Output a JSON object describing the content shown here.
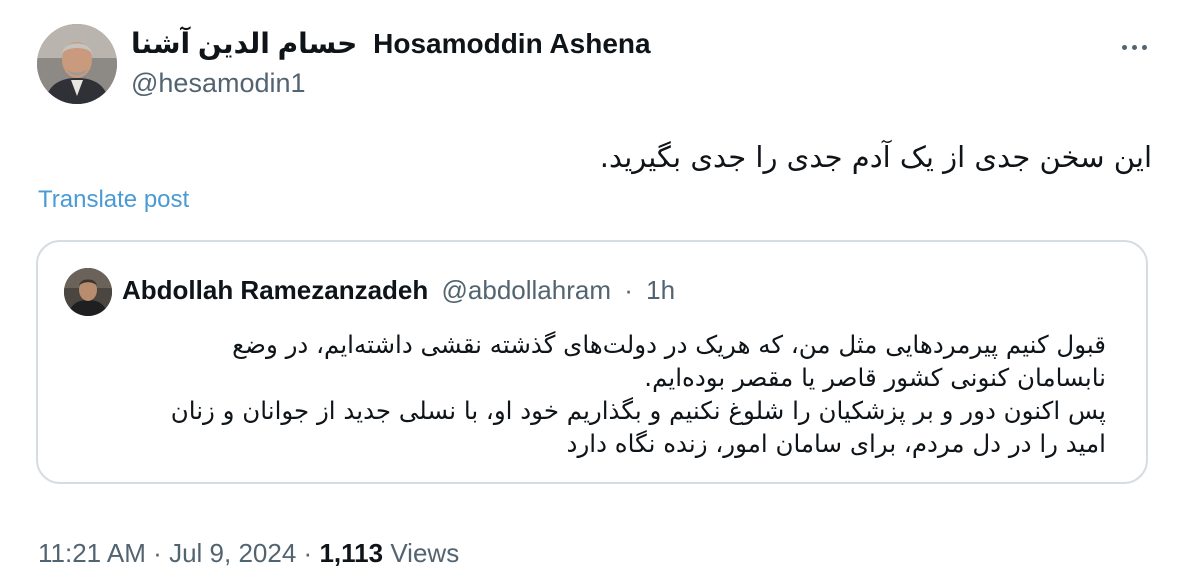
{
  "author": {
    "name_persian": "حسام الدین آشنا",
    "name_latin": "Hosamoddin Ashena",
    "handle": "@hesamodin1"
  },
  "icons": {
    "more": "more-horizontal-icon"
  },
  "tweet": {
    "text": "این سخن جدی از یک آدم جدی را جدی بگیرید.",
    "translate_label": "Translate post"
  },
  "quote": {
    "name": "Abdollah Ramezanzadeh",
    "handle": "@abdollahram",
    "separator": "·",
    "time": "1h",
    "lines": [
      "قبول کنیم پیرمردهایی مثل من، که هریک در دولت‌های گذشته نقشی داشته‌ایم، در وضع",
      "نابسامان کنونی کشور قاصر یا مقصر بوده‌ایم.",
      "پس اکنون دور و بر پزشکیان را شلوغ نکنیم و بگذاریم خود او، با نسلی جدید از جوانان و زنان",
      "امید را در دل مردم، برای سامان امور، زنده نگاه دارد"
    ]
  },
  "footer": {
    "time": "11:21 AM",
    "sep": "·",
    "date": "Jul 9, 2024",
    "views_count": "1,113",
    "views_label": "Views"
  },
  "colors": {
    "link": "#4a9ad4",
    "secondary": "#536471",
    "border": "#d6dde2",
    "text": "#0f1419"
  }
}
